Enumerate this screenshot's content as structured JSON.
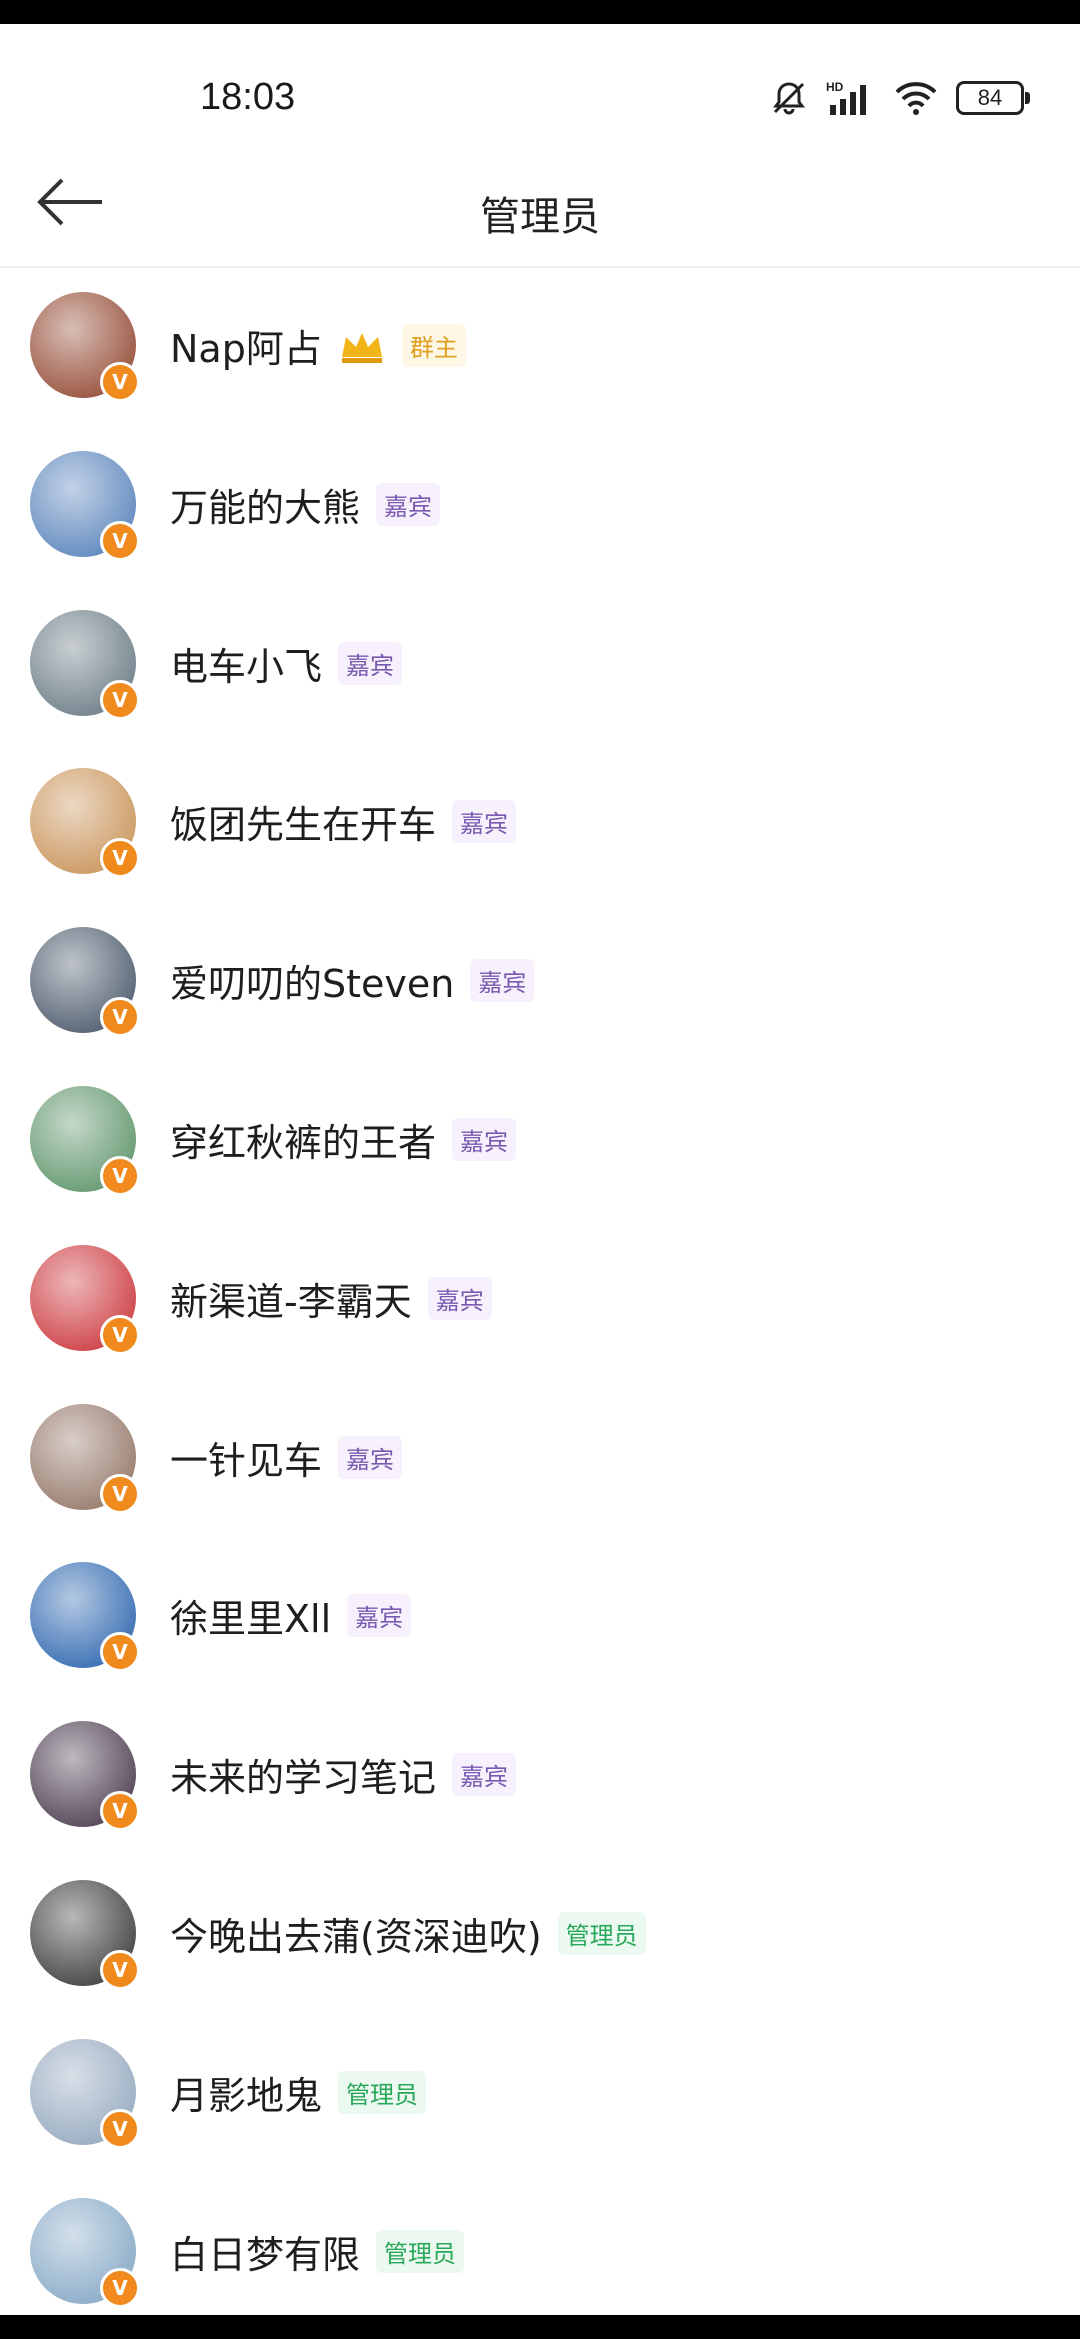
{
  "status_bar": {
    "time": "18:03",
    "battery": "84",
    "icons": [
      "mute-bell-icon",
      "hd-signal-icon",
      "wifi-icon",
      "battery-icon"
    ]
  },
  "header": {
    "title": "管理员",
    "back_icon": "arrow-left-icon"
  },
  "members": [
    {
      "name": "Nap阿占",
      "role": "群主",
      "role_type": "owner",
      "crown": true,
      "avatar_color": "#8a3a22"
    },
    {
      "name": "万能的大熊",
      "role": "嘉宾",
      "role_type": "guest",
      "avatar_color": "#4a78b5"
    },
    {
      "name": "电车小飞",
      "role": "嘉宾",
      "role_type": "guest",
      "avatar_color": "#5d6f7a"
    },
    {
      "name": "饭团先生在开车",
      "role": "嘉宾",
      "role_type": "guest",
      "avatar_color": "#c48a4a"
    },
    {
      "name": "爱叨叨的Steven",
      "role": "嘉宾",
      "role_type": "guest",
      "avatar_color": "#3b4a5e"
    },
    {
      "name": "穿红秋裤的王者",
      "role": "嘉宾",
      "role_type": "guest",
      "avatar_color": "#4f8a5c"
    },
    {
      "name": "新渠道-李霸天",
      "role": "嘉宾",
      "role_type": "guest",
      "avatar_color": "#c7262c"
    },
    {
      "name": "一针见车",
      "role": "嘉宾",
      "role_type": "guest",
      "avatar_color": "#8a6a5a"
    },
    {
      "name": "徐里里Xll",
      "role": "嘉宾",
      "role_type": "guest",
      "avatar_color": "#1c5aa8"
    },
    {
      "name": "未来的学习笔记",
      "role": "嘉宾",
      "role_type": "guest",
      "avatar_color": "#3a2a3e"
    },
    {
      "name": "今晚出去蒲(资深迪吹)",
      "role": "管理员",
      "role_type": "admin",
      "avatar_color": "#2a2a2a"
    },
    {
      "name": "月影地鬼",
      "role": "管理员",
      "role_type": "admin",
      "avatar_color": "#8aa0b8"
    },
    {
      "name": "白日梦有限",
      "role": "管理员",
      "role_type": "admin",
      "avatar_color": "#7aa0c0"
    }
  ],
  "colors": {
    "owner_tag": "#e0a020",
    "guest_tag": "#7a5ab0",
    "admin_tag": "#2aa85a",
    "verified_badge": "#f08a1c"
  }
}
